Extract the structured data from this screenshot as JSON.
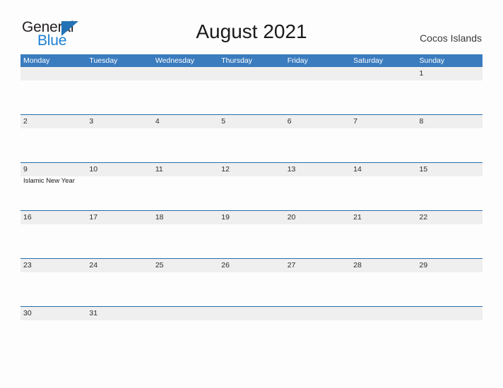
{
  "brand": {
    "name_part1": "General",
    "name_part2": "Blue",
    "flag_icon": "flag-triangle-icon",
    "accent_color": "#1b7fd4"
  },
  "header": {
    "title": "August 2021",
    "region": "Cocos Islands"
  },
  "calendar": {
    "header_background": "#3a7cbe",
    "band_background": "#efefef",
    "divider_color": "#2a6ca8",
    "day_names": [
      "Monday",
      "Tuesday",
      "Wednesday",
      "Thursday",
      "Friday",
      "Saturday",
      "Sunday"
    ],
    "weeks": [
      [
        {
          "day": ""
        },
        {
          "day": ""
        },
        {
          "day": ""
        },
        {
          "day": ""
        },
        {
          "day": ""
        },
        {
          "day": ""
        },
        {
          "day": "1"
        }
      ],
      [
        {
          "day": "2"
        },
        {
          "day": "3"
        },
        {
          "day": "4"
        },
        {
          "day": "5"
        },
        {
          "day": "6"
        },
        {
          "day": "7"
        },
        {
          "day": "8"
        }
      ],
      [
        {
          "day": "9",
          "event": "Islamic New Year"
        },
        {
          "day": "10"
        },
        {
          "day": "11"
        },
        {
          "day": "12"
        },
        {
          "day": "13"
        },
        {
          "day": "14"
        },
        {
          "day": "15"
        }
      ],
      [
        {
          "day": "16"
        },
        {
          "day": "17"
        },
        {
          "day": "18"
        },
        {
          "day": "19"
        },
        {
          "day": "20"
        },
        {
          "day": "21"
        },
        {
          "day": "22"
        }
      ],
      [
        {
          "day": "23"
        },
        {
          "day": "24"
        },
        {
          "day": "25"
        },
        {
          "day": "26"
        },
        {
          "day": "27"
        },
        {
          "day": "28"
        },
        {
          "day": "29"
        }
      ],
      [
        {
          "day": "30"
        },
        {
          "day": "31"
        },
        {
          "day": ""
        },
        {
          "day": ""
        },
        {
          "day": ""
        },
        {
          "day": ""
        },
        {
          "day": ""
        }
      ]
    ]
  }
}
